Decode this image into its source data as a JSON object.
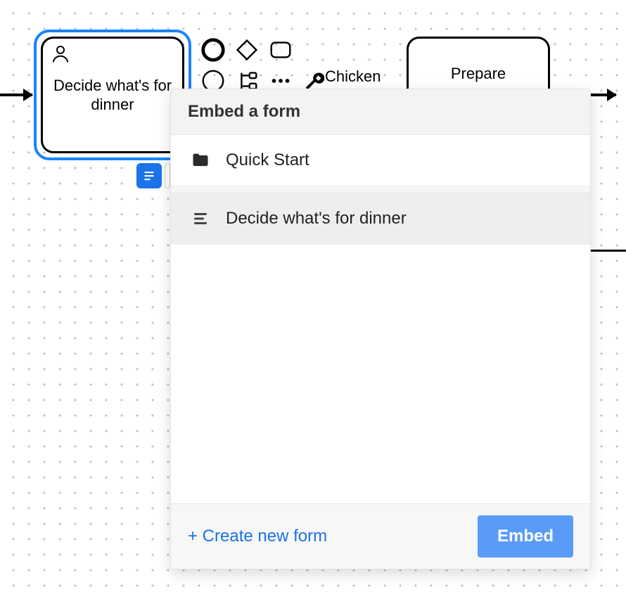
{
  "canvas": {
    "task1": {
      "label": "Decide what's for dinner"
    },
    "task2": {
      "label": "Prepare"
    },
    "edge_label": "Chicken"
  },
  "palette": {
    "shapes": [
      "circle-thick",
      "diamond",
      "rounded-rect",
      "circle-thin",
      "subprocess",
      "dots",
      "wrench"
    ]
  },
  "panel": {
    "title": "Embed a form",
    "items": [
      {
        "icon": "folder",
        "label": "Quick Start",
        "selected": false
      },
      {
        "icon": "form",
        "label": "Decide what's for dinner",
        "selected": true
      }
    ],
    "create_link": "+ Create new form",
    "embed_button": "Embed"
  }
}
